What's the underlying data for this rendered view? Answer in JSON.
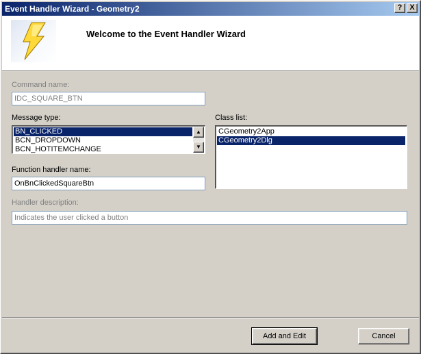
{
  "window": {
    "title": "Event Handler Wizard - Geometry2",
    "help_glyph": "?",
    "close_glyph": "X"
  },
  "banner": {
    "title": "Welcome to the Event Handler Wizard",
    "icon": "lightning-bolt-icon"
  },
  "form": {
    "command_name_label": "Command name:",
    "command_name_value": "IDC_SQUARE_BTN",
    "message_type_label": "Message type:",
    "message_types": [
      "BN_CLICKED",
      "BCN_DROPDOWN",
      "BCN_HOTITEMCHANGE"
    ],
    "message_type_selected": "BN_CLICKED",
    "class_list_label": "Class list:",
    "classes": [
      "CGeometry2App",
      "CGeometry2Dlg"
    ],
    "class_selected": "CGeometry2Dlg",
    "function_handler_label": "Function handler name:",
    "function_handler_value": "OnBnClickedSquareBtn",
    "handler_description_label": "Handler description:",
    "handler_description_value": "Indicates the user clicked a button"
  },
  "buttons": {
    "add_edit_label": "Add and Edit",
    "cancel_label": "Cancel"
  },
  "colors": {
    "title_start": "#0a246a",
    "title_end": "#a6caf0",
    "selection": "#0a246a",
    "face": "#d4d0c8"
  }
}
